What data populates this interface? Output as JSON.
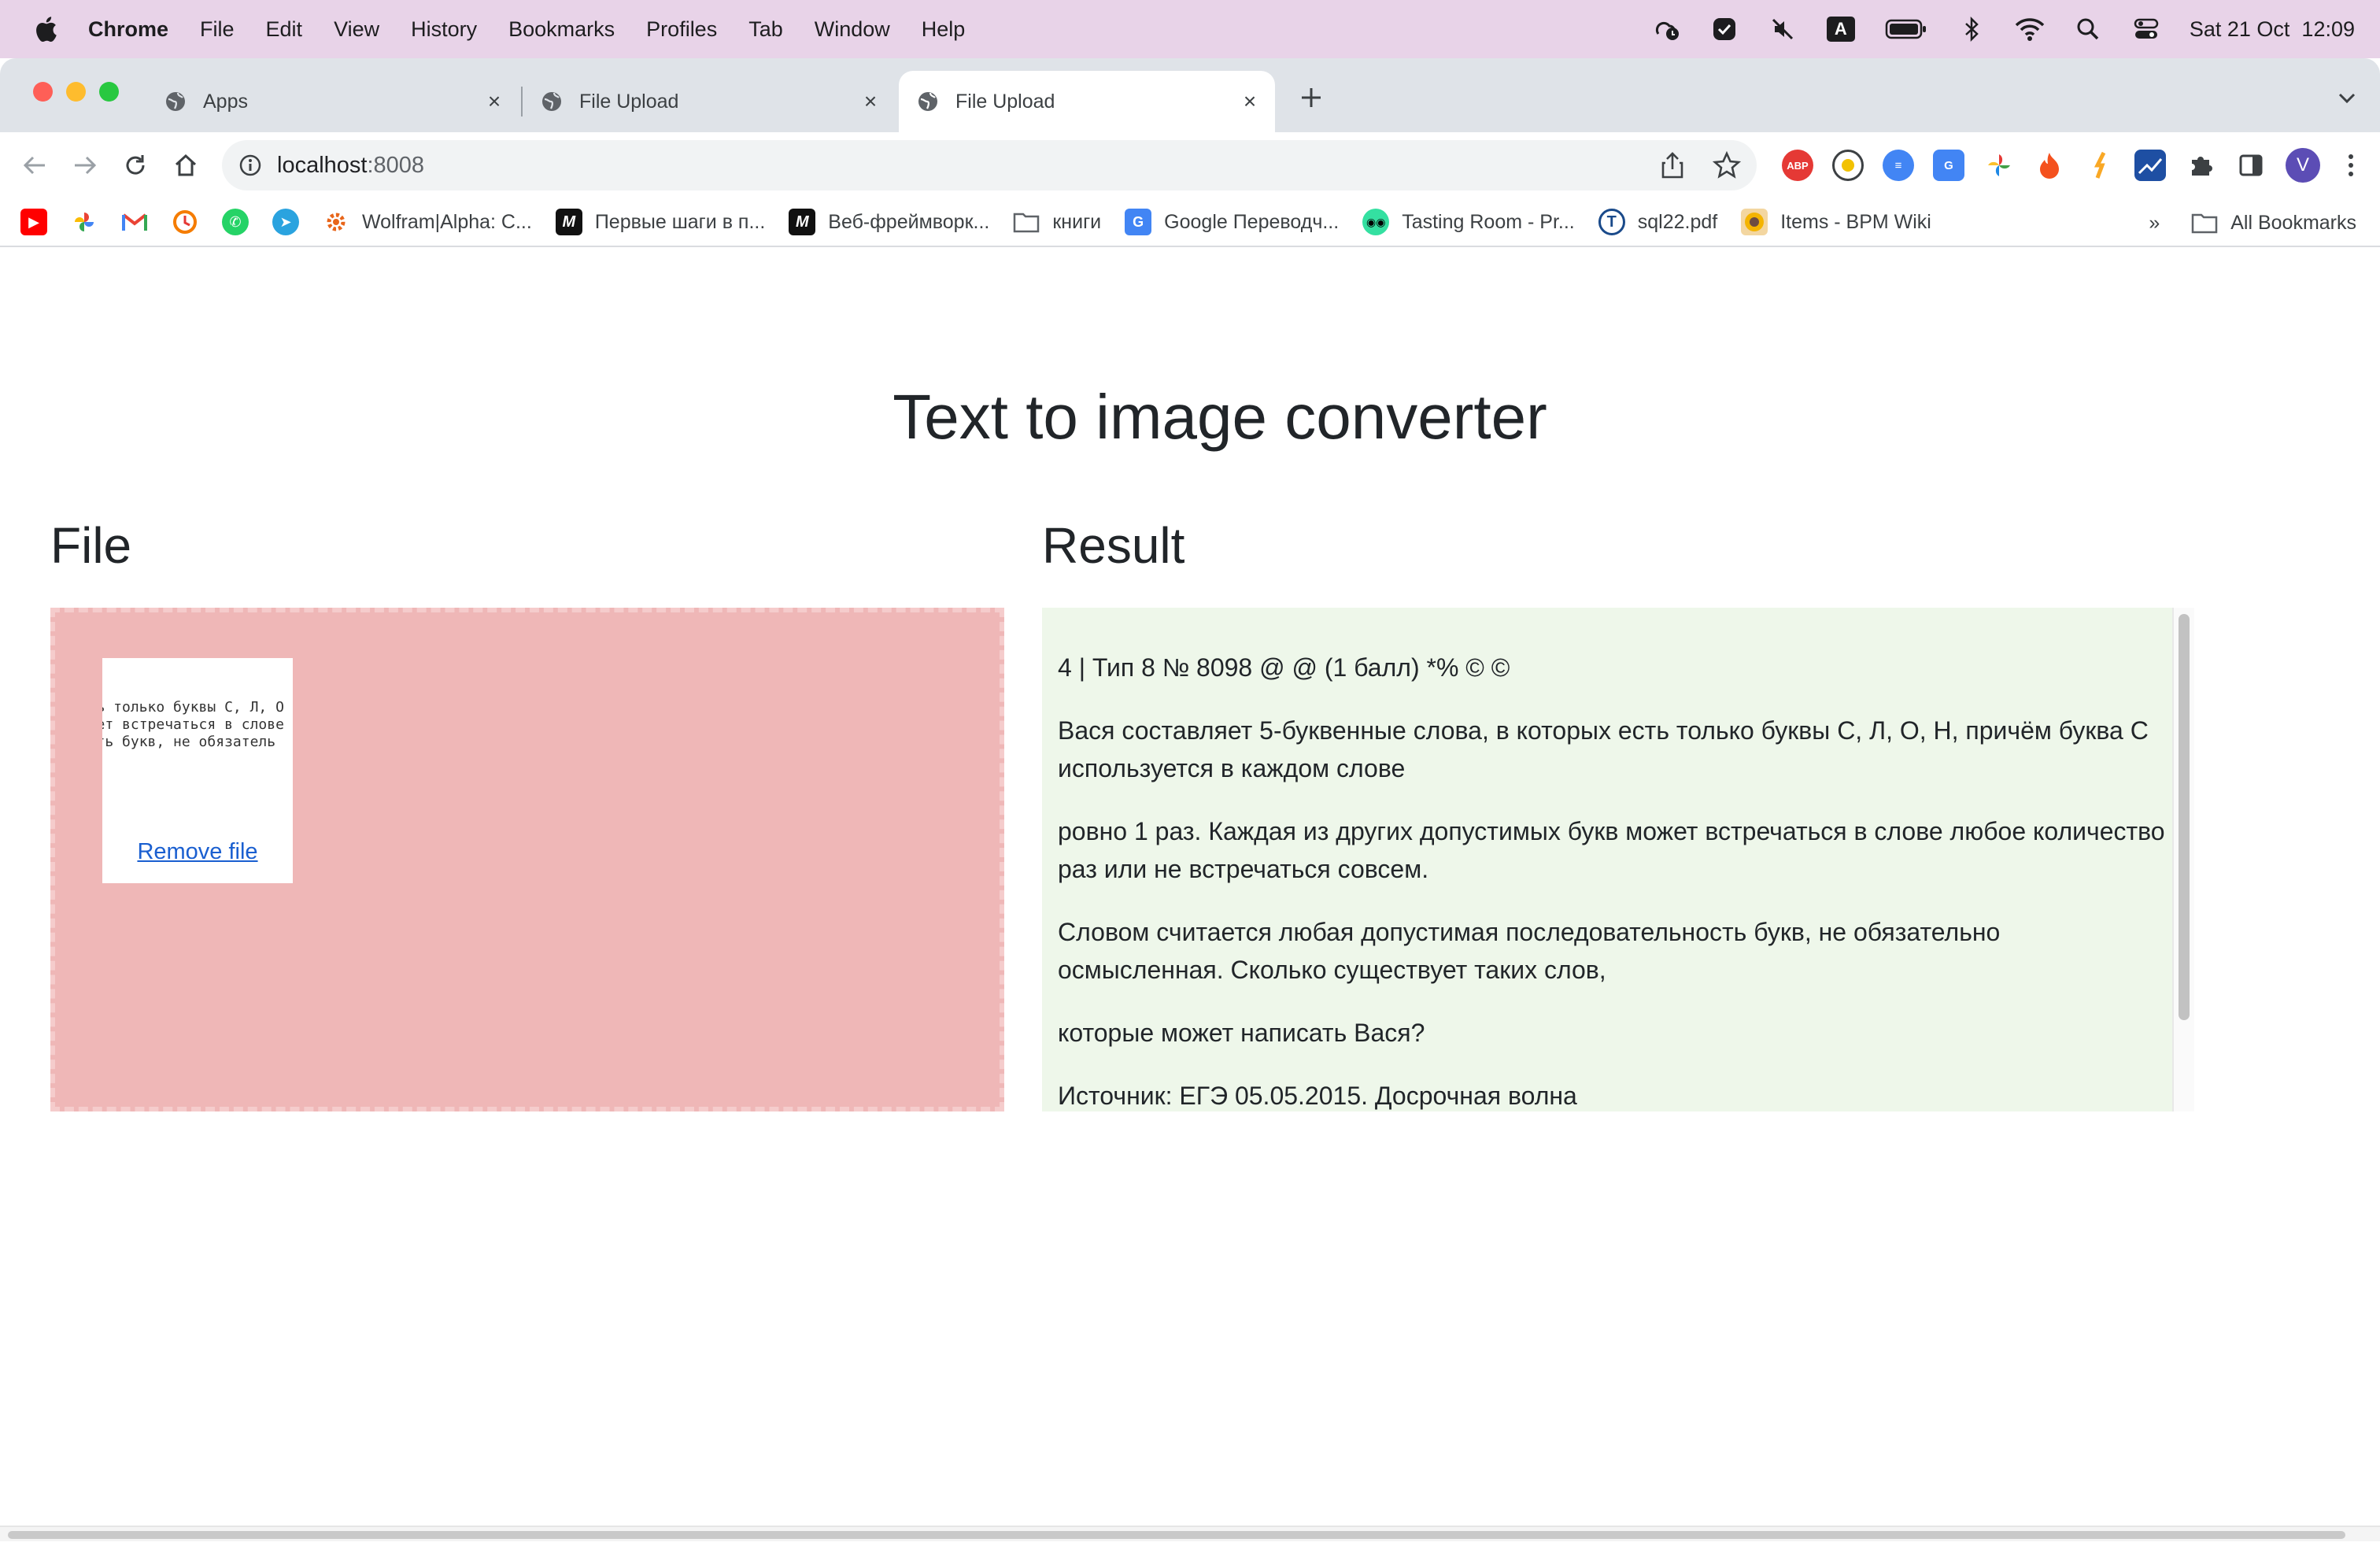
{
  "menubar": {
    "app_name": "Chrome",
    "items": [
      "File",
      "Edit",
      "View",
      "History",
      "Bookmarks",
      "Profiles",
      "Tab",
      "Window",
      "Help"
    ],
    "input_indicator": "A",
    "datetime": "Sat 21 Oct  12:09"
  },
  "tabs": [
    {
      "title": "Apps",
      "active": false
    },
    {
      "title": "File Upload",
      "active": false
    },
    {
      "title": "File Upload",
      "active": true
    }
  ],
  "toolbar": {
    "url_host": "localhost",
    "url_port": ":8008",
    "avatar_letter": "V"
  },
  "bookmarks": {
    "items": [
      "Wolfram|Alpha: C...",
      "Первые шаги в п...",
      "Веб-фреймворк...",
      "книги",
      "Google Переводч...",
      "Tasting Room - Pr...",
      "sql22.pdf",
      "Items - BPM Wiki"
    ],
    "overflow": "»",
    "all_bookmarks": "All Bookmarks"
  },
  "page": {
    "title": "Text to image converter",
    "file_heading": "File",
    "result_heading": "Result",
    "preview_lines": [
      "есть только буквы С, Л, О",
      "может встречаться в слове",
      "ность букв, не обязатель"
    ],
    "remove_file": "Remove file",
    "result_paragraphs": [
      "4 | Тип 8 № 8098 @ @ (1 балл) *% © ©",
      "Вася составляет 5-буквенные слова, в которых есть только буквы С, Л, О, Н, причём буква С используется в каждом слове",
      "ровно 1 раз. Каждая из других допустимых букв может встречаться в слове любое количество раз или не встречаться совсем.",
      "Словом считается любая допустимая последовательность букв, не обязательно осмысленная. Сколько существует таких слов,",
      "которые может написать Вася?",
      "Источник: ЕГЭ 05.05.2015. Досрочная волна"
    ]
  },
  "colors": {
    "dropzone_bg": "#efb7b7",
    "result_bg": "#eef7ea",
    "link": "#1a5fd0",
    "menubar_bg": "#e8d3e8"
  }
}
